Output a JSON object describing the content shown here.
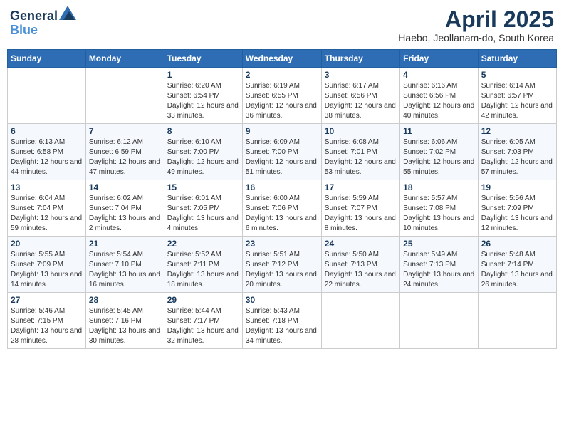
{
  "header": {
    "logo_line1": "General",
    "logo_line2": "Blue",
    "title": "April 2025",
    "location": "Haebo, Jeollanam-do, South Korea"
  },
  "weekdays": [
    "Sunday",
    "Monday",
    "Tuesday",
    "Wednesday",
    "Thursday",
    "Friday",
    "Saturday"
  ],
  "weeks": [
    [
      {
        "day": "",
        "sunrise": "",
        "sunset": "",
        "daylight": ""
      },
      {
        "day": "",
        "sunrise": "",
        "sunset": "",
        "daylight": ""
      },
      {
        "day": "1",
        "sunrise": "Sunrise: 6:20 AM",
        "sunset": "Sunset: 6:54 PM",
        "daylight": "Daylight: 12 hours and 33 minutes."
      },
      {
        "day": "2",
        "sunrise": "Sunrise: 6:19 AM",
        "sunset": "Sunset: 6:55 PM",
        "daylight": "Daylight: 12 hours and 36 minutes."
      },
      {
        "day": "3",
        "sunrise": "Sunrise: 6:17 AM",
        "sunset": "Sunset: 6:56 PM",
        "daylight": "Daylight: 12 hours and 38 minutes."
      },
      {
        "day": "4",
        "sunrise": "Sunrise: 6:16 AM",
        "sunset": "Sunset: 6:56 PM",
        "daylight": "Daylight: 12 hours and 40 minutes."
      },
      {
        "day": "5",
        "sunrise": "Sunrise: 6:14 AM",
        "sunset": "Sunset: 6:57 PM",
        "daylight": "Daylight: 12 hours and 42 minutes."
      }
    ],
    [
      {
        "day": "6",
        "sunrise": "Sunrise: 6:13 AM",
        "sunset": "Sunset: 6:58 PM",
        "daylight": "Daylight: 12 hours and 44 minutes."
      },
      {
        "day": "7",
        "sunrise": "Sunrise: 6:12 AM",
        "sunset": "Sunset: 6:59 PM",
        "daylight": "Daylight: 12 hours and 47 minutes."
      },
      {
        "day": "8",
        "sunrise": "Sunrise: 6:10 AM",
        "sunset": "Sunset: 7:00 PM",
        "daylight": "Daylight: 12 hours and 49 minutes."
      },
      {
        "day": "9",
        "sunrise": "Sunrise: 6:09 AM",
        "sunset": "Sunset: 7:00 PM",
        "daylight": "Daylight: 12 hours and 51 minutes."
      },
      {
        "day": "10",
        "sunrise": "Sunrise: 6:08 AM",
        "sunset": "Sunset: 7:01 PM",
        "daylight": "Daylight: 12 hours and 53 minutes."
      },
      {
        "day": "11",
        "sunrise": "Sunrise: 6:06 AM",
        "sunset": "Sunset: 7:02 PM",
        "daylight": "Daylight: 12 hours and 55 minutes."
      },
      {
        "day": "12",
        "sunrise": "Sunrise: 6:05 AM",
        "sunset": "Sunset: 7:03 PM",
        "daylight": "Daylight: 12 hours and 57 minutes."
      }
    ],
    [
      {
        "day": "13",
        "sunrise": "Sunrise: 6:04 AM",
        "sunset": "Sunset: 7:04 PM",
        "daylight": "Daylight: 12 hours and 59 minutes."
      },
      {
        "day": "14",
        "sunrise": "Sunrise: 6:02 AM",
        "sunset": "Sunset: 7:04 PM",
        "daylight": "Daylight: 13 hours and 2 minutes."
      },
      {
        "day": "15",
        "sunrise": "Sunrise: 6:01 AM",
        "sunset": "Sunset: 7:05 PM",
        "daylight": "Daylight: 13 hours and 4 minutes."
      },
      {
        "day": "16",
        "sunrise": "Sunrise: 6:00 AM",
        "sunset": "Sunset: 7:06 PM",
        "daylight": "Daylight: 13 hours and 6 minutes."
      },
      {
        "day": "17",
        "sunrise": "Sunrise: 5:59 AM",
        "sunset": "Sunset: 7:07 PM",
        "daylight": "Daylight: 13 hours and 8 minutes."
      },
      {
        "day": "18",
        "sunrise": "Sunrise: 5:57 AM",
        "sunset": "Sunset: 7:08 PM",
        "daylight": "Daylight: 13 hours and 10 minutes."
      },
      {
        "day": "19",
        "sunrise": "Sunrise: 5:56 AM",
        "sunset": "Sunset: 7:09 PM",
        "daylight": "Daylight: 13 hours and 12 minutes."
      }
    ],
    [
      {
        "day": "20",
        "sunrise": "Sunrise: 5:55 AM",
        "sunset": "Sunset: 7:09 PM",
        "daylight": "Daylight: 13 hours and 14 minutes."
      },
      {
        "day": "21",
        "sunrise": "Sunrise: 5:54 AM",
        "sunset": "Sunset: 7:10 PM",
        "daylight": "Daylight: 13 hours and 16 minutes."
      },
      {
        "day": "22",
        "sunrise": "Sunrise: 5:52 AM",
        "sunset": "Sunset: 7:11 PM",
        "daylight": "Daylight: 13 hours and 18 minutes."
      },
      {
        "day": "23",
        "sunrise": "Sunrise: 5:51 AM",
        "sunset": "Sunset: 7:12 PM",
        "daylight": "Daylight: 13 hours and 20 minutes."
      },
      {
        "day": "24",
        "sunrise": "Sunrise: 5:50 AM",
        "sunset": "Sunset: 7:13 PM",
        "daylight": "Daylight: 13 hours and 22 minutes."
      },
      {
        "day": "25",
        "sunrise": "Sunrise: 5:49 AM",
        "sunset": "Sunset: 7:13 PM",
        "daylight": "Daylight: 13 hours and 24 minutes."
      },
      {
        "day": "26",
        "sunrise": "Sunrise: 5:48 AM",
        "sunset": "Sunset: 7:14 PM",
        "daylight": "Daylight: 13 hours and 26 minutes."
      }
    ],
    [
      {
        "day": "27",
        "sunrise": "Sunrise: 5:46 AM",
        "sunset": "Sunset: 7:15 PM",
        "daylight": "Daylight: 13 hours and 28 minutes."
      },
      {
        "day": "28",
        "sunrise": "Sunrise: 5:45 AM",
        "sunset": "Sunset: 7:16 PM",
        "daylight": "Daylight: 13 hours and 30 minutes."
      },
      {
        "day": "29",
        "sunrise": "Sunrise: 5:44 AM",
        "sunset": "Sunset: 7:17 PM",
        "daylight": "Daylight: 13 hours and 32 minutes."
      },
      {
        "day": "30",
        "sunrise": "Sunrise: 5:43 AM",
        "sunset": "Sunset: 7:18 PM",
        "daylight": "Daylight: 13 hours and 34 minutes."
      },
      {
        "day": "",
        "sunrise": "",
        "sunset": "",
        "daylight": ""
      },
      {
        "day": "",
        "sunrise": "",
        "sunset": "",
        "daylight": ""
      },
      {
        "day": "",
        "sunrise": "",
        "sunset": "",
        "daylight": ""
      }
    ]
  ]
}
